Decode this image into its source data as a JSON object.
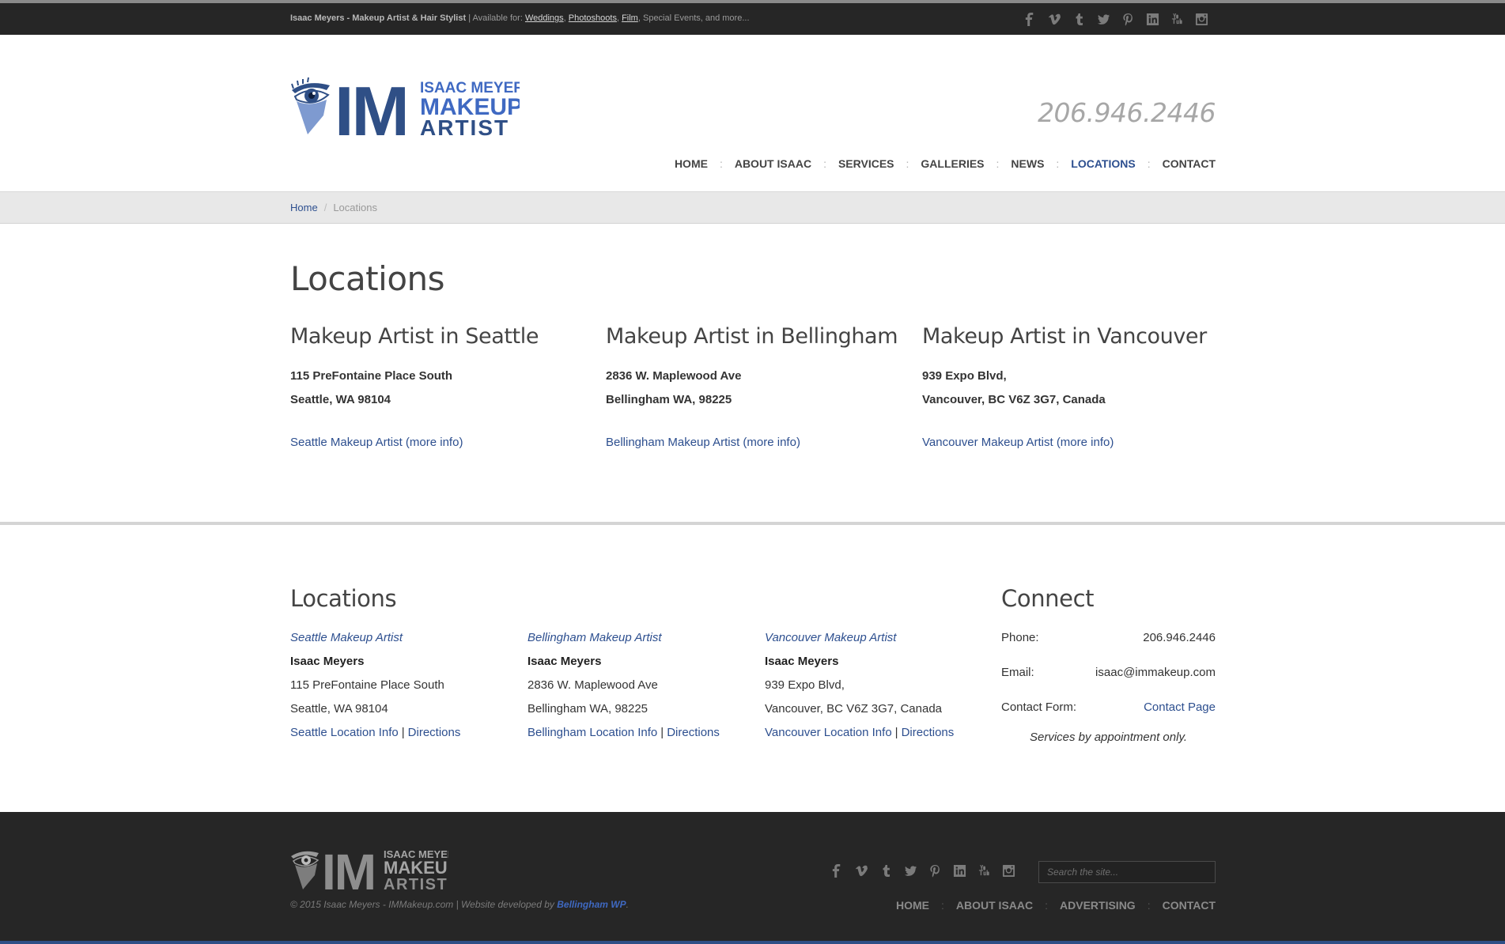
{
  "topbar": {
    "brand": "Isaac Meyers - Makeup Artist & Hair Stylist",
    "separator": "|",
    "available_label": "Available for:",
    "links": [
      "Weddings",
      "Photoshoots",
      "Film"
    ],
    "tail": "Special Events, and more...",
    "social_icons": [
      "facebook-icon",
      "vimeo-icon",
      "tumblr-icon",
      "twitter-icon",
      "pinterest-icon",
      "linkedin-icon",
      "youtube-icon",
      "instagram-icon"
    ]
  },
  "header": {
    "logo": {
      "line1": "ISAAC MEYERS",
      "line2": "MAKEUP",
      "line3": "ARTIST",
      "monogram": "IM"
    },
    "phone": "206.946.2446",
    "nav": [
      "HOME",
      "ABOUT ISAAC",
      "SERVICES",
      "GALLERIES",
      "NEWS",
      "LOCATIONS",
      "CONTACT"
    ],
    "nav_separator": ":",
    "active_nav": "LOCATIONS"
  },
  "breadcrumb": {
    "home": "Home",
    "separator": "/",
    "current": "Locations"
  },
  "content": {
    "title": "Locations",
    "locations": [
      {
        "heading": "Makeup Artist in Seattle",
        "line1": "115 PreFontaine Place South",
        "line2": "Seattle, WA 98104",
        "link": "Seattle Makeup Artist",
        "more": "(more info)"
      },
      {
        "heading": "Makeup Artist in Bellingham",
        "line1": "2836 W. Maplewood Ave",
        "line2": "Bellingham WA, 98225",
        "link": "Bellingham Makeup Artist",
        "more": "(more info)"
      },
      {
        "heading": "Makeup Artist in Vancouver",
        "line1": "939 Expo Blvd,",
        "line2": "Vancouver, BC V6Z 3G7, Canada",
        "link": "Vancouver Makeup Artist",
        "more": "(more info)"
      }
    ]
  },
  "widgets": {
    "locations_title": "Locations",
    "locations": [
      {
        "title": "Seattle Makeup Artist",
        "name": "Isaac Meyers",
        "line1": "115 PreFontaine Place South",
        "line2": "Seattle, WA 98104",
        "info": "Seattle Location Info",
        "directions": "Directions"
      },
      {
        "title": "Bellingham Makeup Artist",
        "name": "Isaac Meyers",
        "line1": "2836 W. Maplewood Ave",
        "line2": "Bellingham WA, 98225",
        "info": "Bellingham Location Info",
        "directions": "Directions"
      },
      {
        "title": "Vancouver Makeup Artist",
        "name": "Isaac Meyers",
        "line1": "939 Expo Blvd,",
        "line2": "Vancouver, BC V6Z 3G7, Canada",
        "info": "Vancouver Location Info",
        "directions": "Directions"
      }
    ],
    "pipe": "|",
    "connect_title": "Connect",
    "connect": {
      "phone_label": "Phone:",
      "phone": "206.946.2446",
      "email_label": "Email:",
      "email": "isaac@immakeup.com",
      "form_label": "Contact Form:",
      "form_link": "Contact Page",
      "note": "Services by appointment only."
    }
  },
  "footer": {
    "copyright": "© 2015 Isaac Meyers - IMMakeup.com | Website developed by",
    "developer": "Bellingham WP",
    "period": ".",
    "search_placeholder": "Search the site...",
    "nav": [
      "HOME",
      "ABOUT ISAAC",
      "ADVERTISING",
      "CONTACT"
    ],
    "nav_separator": ":"
  },
  "colors": {
    "accent": "#2d4f8f",
    "dark_bar": "#262626",
    "footer_link": "#3f69c2"
  }
}
